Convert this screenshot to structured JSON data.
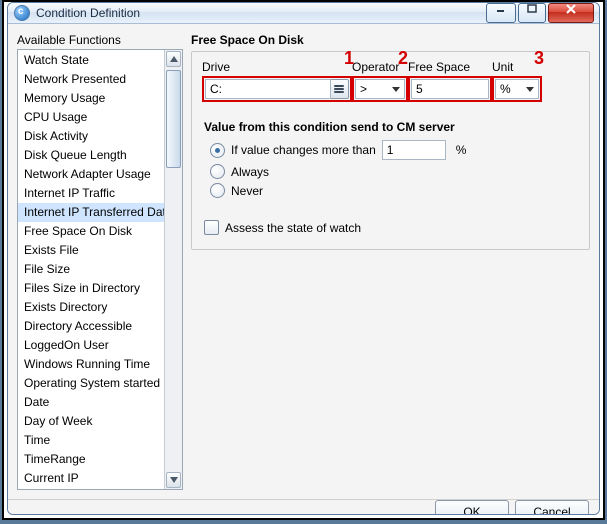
{
  "window": {
    "title": "Condition Definition"
  },
  "left": {
    "label": "Available Functions",
    "selected_index": 8,
    "items": [
      "Watch State",
      "Network Presented",
      "Memory Usage",
      "CPU Usage",
      "Disk Activity",
      "Disk Queue Length",
      "Network Adapter Usage",
      "Internet IP Traffic",
      "Internet IP Transferred Data",
      "Free Space On Disk",
      "Exists File",
      "File Size",
      "Files Size in Directory",
      "Exists Directory",
      "Directory Accessible",
      "LoggedOn User",
      "Windows Running Time",
      "Operating System started",
      "Date",
      "Day of Week",
      "Time",
      "TimeRange",
      "Current IP"
    ]
  },
  "main": {
    "heading": "Free Space On Disk",
    "labels": {
      "drive": "Drive",
      "operator": "Operator",
      "free_space": "Free Space",
      "unit": "Unit"
    },
    "values": {
      "drive": "C:",
      "operator": ">",
      "free_space": "5",
      "unit": "%"
    },
    "callouts": {
      "c1": "1",
      "c2": "2",
      "c3": "3"
    },
    "callout_color": "#d40000"
  },
  "condition_send": {
    "heading": "Value from this condition send to CM server",
    "opt_change": "If value changes more than",
    "opt_change_value": "1",
    "opt_change_unit": "%",
    "opt_always": "Always",
    "opt_never": "Never",
    "selected": "change"
  },
  "assess": {
    "label": "Assess the state of watch",
    "checked": false
  },
  "footer": {
    "ok": "OK",
    "cancel": "Cancel"
  }
}
